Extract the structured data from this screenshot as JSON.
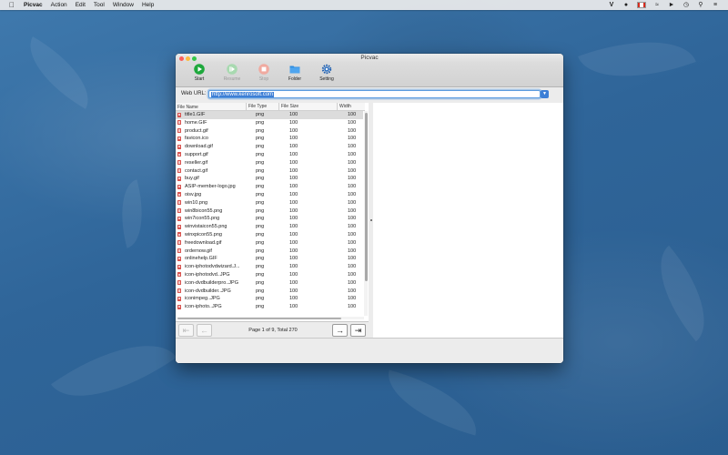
{
  "menubar": {
    "items": [
      "Picvac",
      "Action",
      "Edit",
      "Tool",
      "Window",
      "Help"
    ]
  },
  "window": {
    "title": "Picvac"
  },
  "toolbar": {
    "start": "Start",
    "resume": "Resume",
    "stop": "Stop",
    "folder": "Folder",
    "setting": "Setting"
  },
  "urlbar": {
    "label": "Web URL:",
    "value": "http://www.kenrosoft.com"
  },
  "table": {
    "headers": [
      "File Name",
      "File Type",
      "File Size",
      "Width"
    ],
    "rows": [
      [
        "title1.GIF",
        "png",
        "100",
        "100"
      ],
      [
        "home.GIF",
        "png",
        "100",
        "100"
      ],
      [
        "product.gif",
        "png",
        "100",
        "100"
      ],
      [
        "favicon.ico",
        "png",
        "100",
        "100"
      ],
      [
        "download.gif",
        "png",
        "100",
        "100"
      ],
      [
        "support.gif",
        "png",
        "100",
        "100"
      ],
      [
        "reseller.gif",
        "png",
        "100",
        "100"
      ],
      [
        "contact.gif",
        "png",
        "100",
        "100"
      ],
      [
        "buy.gif",
        "png",
        "100",
        "100"
      ],
      [
        "ASIP-member-logo.jpg",
        "png",
        "100",
        "100"
      ],
      [
        "oisv.jpg",
        "png",
        "100",
        "100"
      ],
      [
        "win10.png",
        "png",
        "100",
        "100"
      ],
      [
        "win8bicon55.png",
        "png",
        "100",
        "100"
      ],
      [
        "win7icon55.png",
        "png",
        "100",
        "100"
      ],
      [
        "winvistaicon55.png",
        "png",
        "100",
        "100"
      ],
      [
        "winxpicon55.png",
        "png",
        "100",
        "100"
      ],
      [
        "freedownload.gif",
        "png",
        "100",
        "100"
      ],
      [
        "ordernow.gif",
        "png",
        "100",
        "100"
      ],
      [
        "onlinehelp.GIF",
        "png",
        "100",
        "100"
      ],
      [
        "icon-iphotodvdwizard.J...",
        "png",
        "100",
        "100"
      ],
      [
        "icon-iphotodvd..JPG",
        "png",
        "100",
        "100"
      ],
      [
        "icon-dvdbuilderpro..JPG",
        "png",
        "100",
        "100"
      ],
      [
        "icon-dvdbuilder..JPG",
        "png",
        "100",
        "100"
      ],
      [
        "iconimpeg..JPG",
        "png",
        "100",
        "100"
      ],
      [
        "icon-iphoto..JPG",
        "png",
        "100",
        "100"
      ]
    ]
  },
  "pager": {
    "info": "Page 1 of 9, Total 270"
  }
}
